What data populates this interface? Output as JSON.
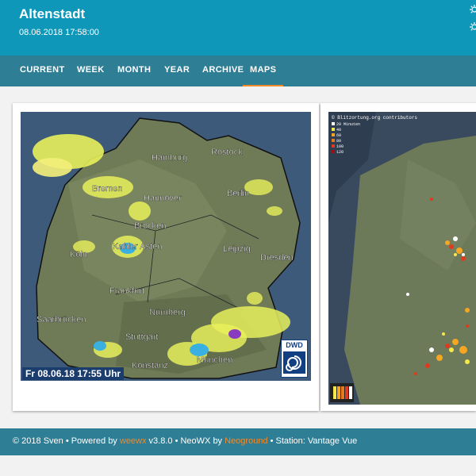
{
  "header": {
    "title": "Altenstadt",
    "datetime": "08.06.2018 17:58:00",
    "icons": [
      "sunrise-icon",
      "sunset-icon"
    ]
  },
  "nav": {
    "items": [
      {
        "label": "CURRENT"
      },
      {
        "label": "WEEK"
      },
      {
        "label": "MONTH"
      },
      {
        "label": "YEAR"
      },
      {
        "label": "ARCHIVE"
      },
      {
        "label": "MAPS",
        "active": true
      }
    ]
  },
  "radar_map": {
    "caption": "Fr 08.06.18   17:55 Uhr",
    "logo": "DWD",
    "cities": [
      "Hamburg",
      "Rostock",
      "Bremen",
      "Hannover",
      "Berlin",
      "Brocken",
      "Köln",
      "Kahler Asten",
      "Leipzig",
      "Dresden",
      "Frankfurt",
      "Saarbrücken",
      "Nürnberg",
      "Stuttgart",
      "München",
      "Konstanz"
    ]
  },
  "lightning_map": {
    "title": "© Blitzortung.org contributors",
    "legend": [
      "20 Minuten",
      "40",
      "60",
      "80",
      "100",
      "120"
    ]
  },
  "footer": {
    "copyright": "© 2018 Sven • Powered by ",
    "weewx_link": "weewx",
    "version": " v3.8.0 • NeoWX by ",
    "neoground_link": "Neoground",
    "station": " • Station: Vantage Vue"
  },
  "colors": {
    "header": "#0e97b9",
    "nav": "#2e7e95",
    "accent": "#f08a2a"
  }
}
